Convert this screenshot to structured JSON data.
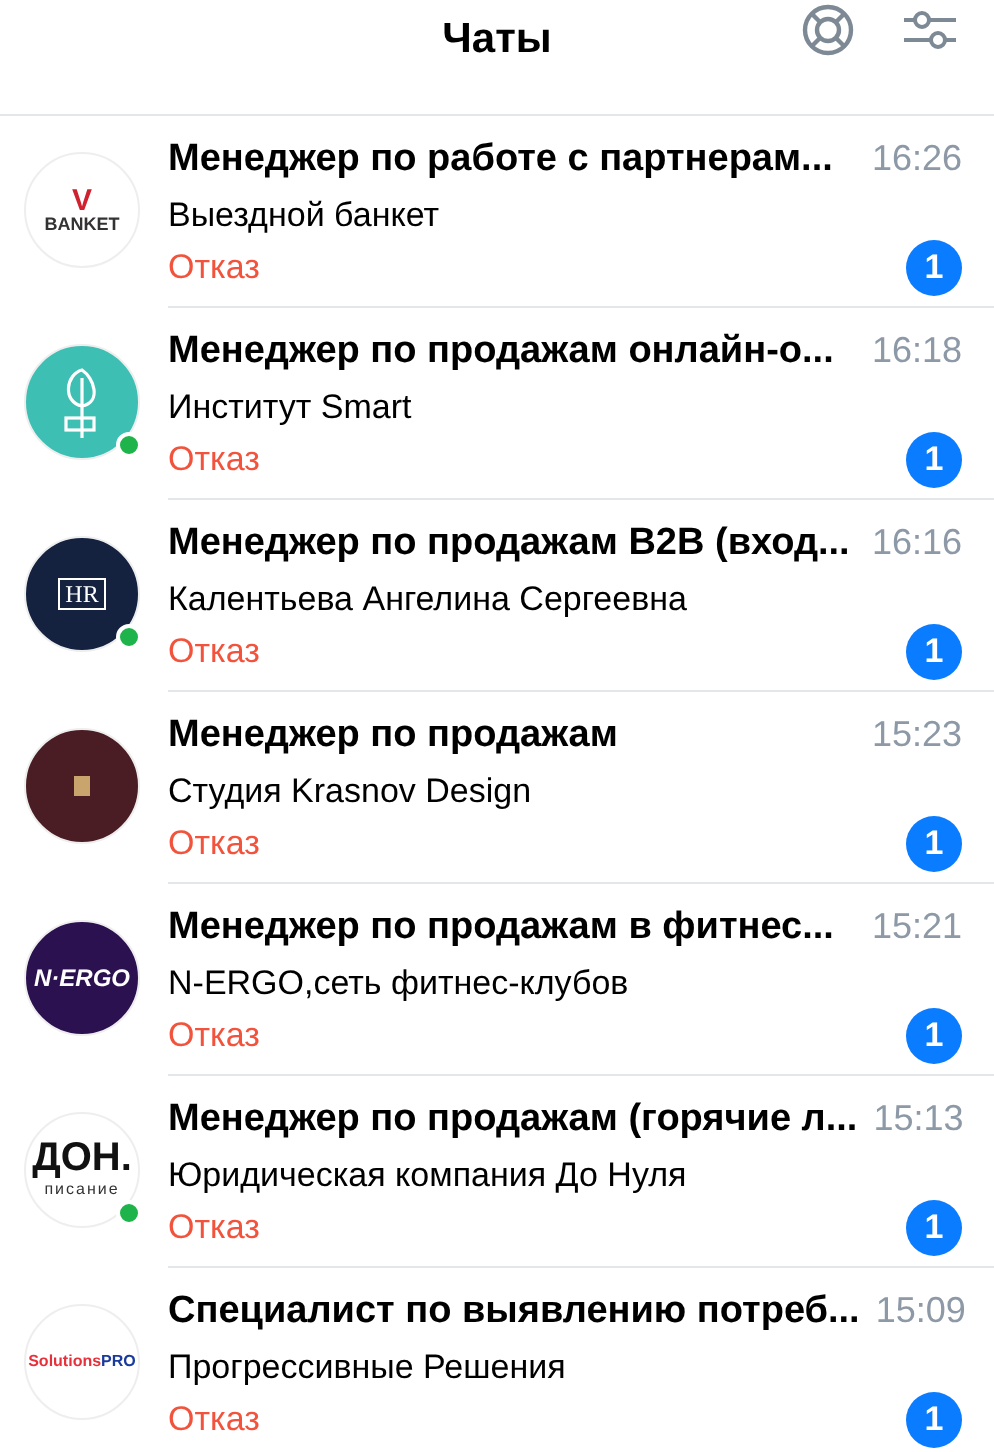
{
  "header": {
    "title": "Чаты"
  },
  "chats": [
    {
      "title": "Менеджер по работе с партнерам...",
      "company": "Выездной банкет",
      "status": "Отказ",
      "time": "16:26",
      "unread": "1",
      "online": false,
      "avatar": {
        "kind": "banket",
        "logo_mark": "V",
        "logo_text": "BANKET",
        "color": "#ffffff"
      }
    },
    {
      "title": "Менеджер по продажам онлайн-о...",
      "company": "Институт Smart",
      "status": "Отказ",
      "time": "16:18",
      "unread": "1",
      "online": true,
      "avatar": {
        "kind": "plant",
        "color": "#3dbfb3"
      }
    },
    {
      "title": "Менеджер по продажам B2B (вход...",
      "company": "Калентьева Ангелина Сергеевна",
      "status": "Отказ",
      "time": "16:16",
      "unread": "1",
      "online": true,
      "avatar": {
        "kind": "boxed",
        "logo_text": "HR",
        "color": "#14213f"
      }
    },
    {
      "title": "Менеджер по продажам",
      "company": "Студия Krasnov Design",
      "status": "Отказ",
      "time": "15:23",
      "unread": "1",
      "online": false,
      "avatar": {
        "kind": "plain",
        "color": "#4a1d24"
      }
    },
    {
      "title": "Менеджер по продажам в фитнес...",
      "company": "N-ERGO,сеть фитнес-клубов",
      "status": "Отказ",
      "time": "15:21",
      "unread": "1",
      "online": false,
      "avatar": {
        "kind": "word",
        "logo_text": "N·ERGO",
        "color": "#2c1150"
      }
    },
    {
      "title": "Менеджер по продажам (горячие л...",
      "company": "Юридическая компания До Нуля",
      "status": "Отказ",
      "time": "15:13",
      "unread": "1",
      "online": true,
      "avatar": {
        "kind": "don",
        "logo_text": "ДОН.",
        "logo_sub": "писание",
        "color": "#ffffff"
      }
    },
    {
      "title": "Специалист по выявлению потреб...",
      "company": "Прогрессивные Решения",
      "status": "Отказ",
      "time": "15:09",
      "unread": "1",
      "online": false,
      "avatar": {
        "kind": "solutions",
        "logo_text": "Solutions",
        "logo_mark": "PRO",
        "color": "#ffffff"
      }
    }
  ]
}
